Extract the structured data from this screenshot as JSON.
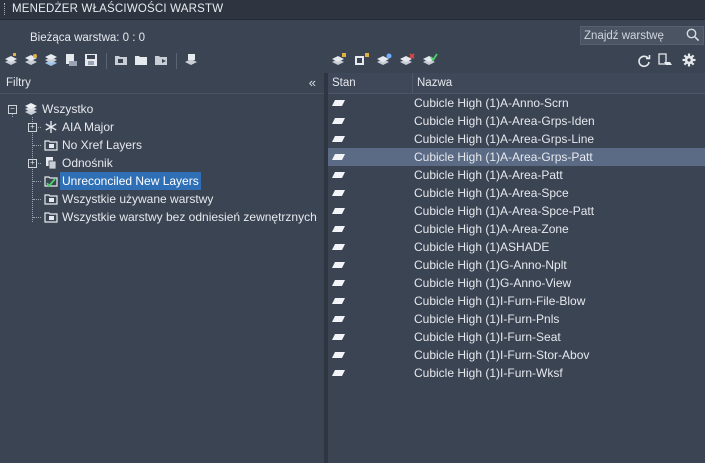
{
  "window": {
    "title": "MENEDŻER WŁAŚCIWOŚCI WARSTW"
  },
  "status": {
    "current_layer": "Bieżąca warstwa: 0 : 0"
  },
  "search": {
    "placeholder": "Znajdź warstwę"
  },
  "filters": {
    "header": "Filtry",
    "collapse_glyph": "«",
    "tree": {
      "root": "Wszystko",
      "children": [
        {
          "label": "AIA Major"
        },
        {
          "label": "No Xref Layers"
        },
        {
          "label": "Odnośnik"
        },
        {
          "label": "Unreconciled New Layers"
        },
        {
          "label": "Wszystkie używane warstwy"
        },
        {
          "label": "Wszystkie warstwy bez odniesień zewnętrznych"
        }
      ]
    }
  },
  "layers": {
    "columns": [
      "Stan",
      "Nazwa"
    ],
    "selected_index": 3,
    "rows": [
      {
        "name": "Cubicle High (1)A-Anno-Scrn"
      },
      {
        "name": "Cubicle High (1)A-Area-Grps-Iden"
      },
      {
        "name": "Cubicle High (1)A-Area-Grps-Line"
      },
      {
        "name": "Cubicle High (1)A-Area-Grps-Patt"
      },
      {
        "name": "Cubicle High (1)A-Area-Patt"
      },
      {
        "name": "Cubicle High (1)A-Area-Spce"
      },
      {
        "name": "Cubicle High (1)A-Area-Spce-Patt"
      },
      {
        "name": "Cubicle High (1)A-Area-Zone"
      },
      {
        "name": "Cubicle High (1)ASHADE"
      },
      {
        "name": "Cubicle High (1)G-Anno-Nplt"
      },
      {
        "name": "Cubicle High (1)G-Anno-View"
      },
      {
        "name": "Cubicle High (1)I-Furn-File-Blow"
      },
      {
        "name": "Cubicle High (1)I-Furn-Pnls"
      },
      {
        "name": "Cubicle High (1)I-Furn-Seat"
      },
      {
        "name": "Cubicle High (1)I-Furn-Stor-Abov"
      },
      {
        "name": "Cubicle High (1)I-Furn-Wksf"
      }
    ]
  },
  "icons": {
    "toolbar_left": [
      "new-property-filter-icon",
      "new-group-filter-icon",
      "layer-states-icon",
      "new-layer-icon",
      "new-layer-vp-frozen-icon",
      "delete-layer-icon",
      "set-current-icon",
      "layer-walk-icon",
      "layer-translate-icon",
      "layer-isolate-icon"
    ],
    "toolbar_right": [
      "refresh-icon",
      "layer-settings-dialog-icon",
      "settings-gear-icon"
    ],
    "accent": "#2f6fb5",
    "row_selected": "#5b6b85"
  }
}
